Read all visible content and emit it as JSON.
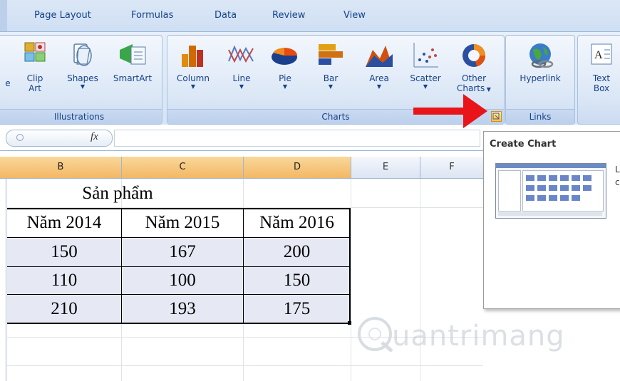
{
  "tabs": [
    "Page Layout",
    "Formulas",
    "Data",
    "Review",
    "View"
  ],
  "ribbon": {
    "illustrations": {
      "caption": "Illustrations",
      "buttons": [
        {
          "label1": "Clip",
          "label2": "Art"
        },
        {
          "label1": "Shapes",
          "label2": ""
        },
        {
          "label1": "SmartArt",
          "label2": ""
        }
      ]
    },
    "charts": {
      "caption": "Charts",
      "buttons": [
        {
          "label1": "Column"
        },
        {
          "label1": "Line"
        },
        {
          "label1": "Pie"
        },
        {
          "label1": "Bar"
        },
        {
          "label1": "Area"
        },
        {
          "label1": "Scatter"
        },
        {
          "label1": "Other",
          "label2": "Charts"
        }
      ]
    },
    "links": {
      "caption": "Links",
      "hyperlink": "Hyperlink"
    },
    "text": {
      "label1": "Text",
      "label2": "Box"
    }
  },
  "formula_bar": {
    "fx": "fx"
  },
  "columns": [
    "B",
    "C",
    "D",
    "E",
    "F"
  ],
  "sheet": {
    "title": "Sản phẩm",
    "headers": [
      "Năm 2014",
      "Năm 2015",
      "Năm 2016"
    ],
    "rows": [
      [
        "150",
        "167",
        "200"
      ],
      [
        "110",
        "100",
        "150"
      ],
      [
        "210",
        "193",
        "175"
      ]
    ]
  },
  "tooltip": {
    "title": "Create Chart",
    "cut1": "L",
    "cut2": "c"
  },
  "watermark": "uantrimang",
  "colors": {
    "accent_arrow": "#e8141a",
    "selected_header": "#f4b764"
  }
}
